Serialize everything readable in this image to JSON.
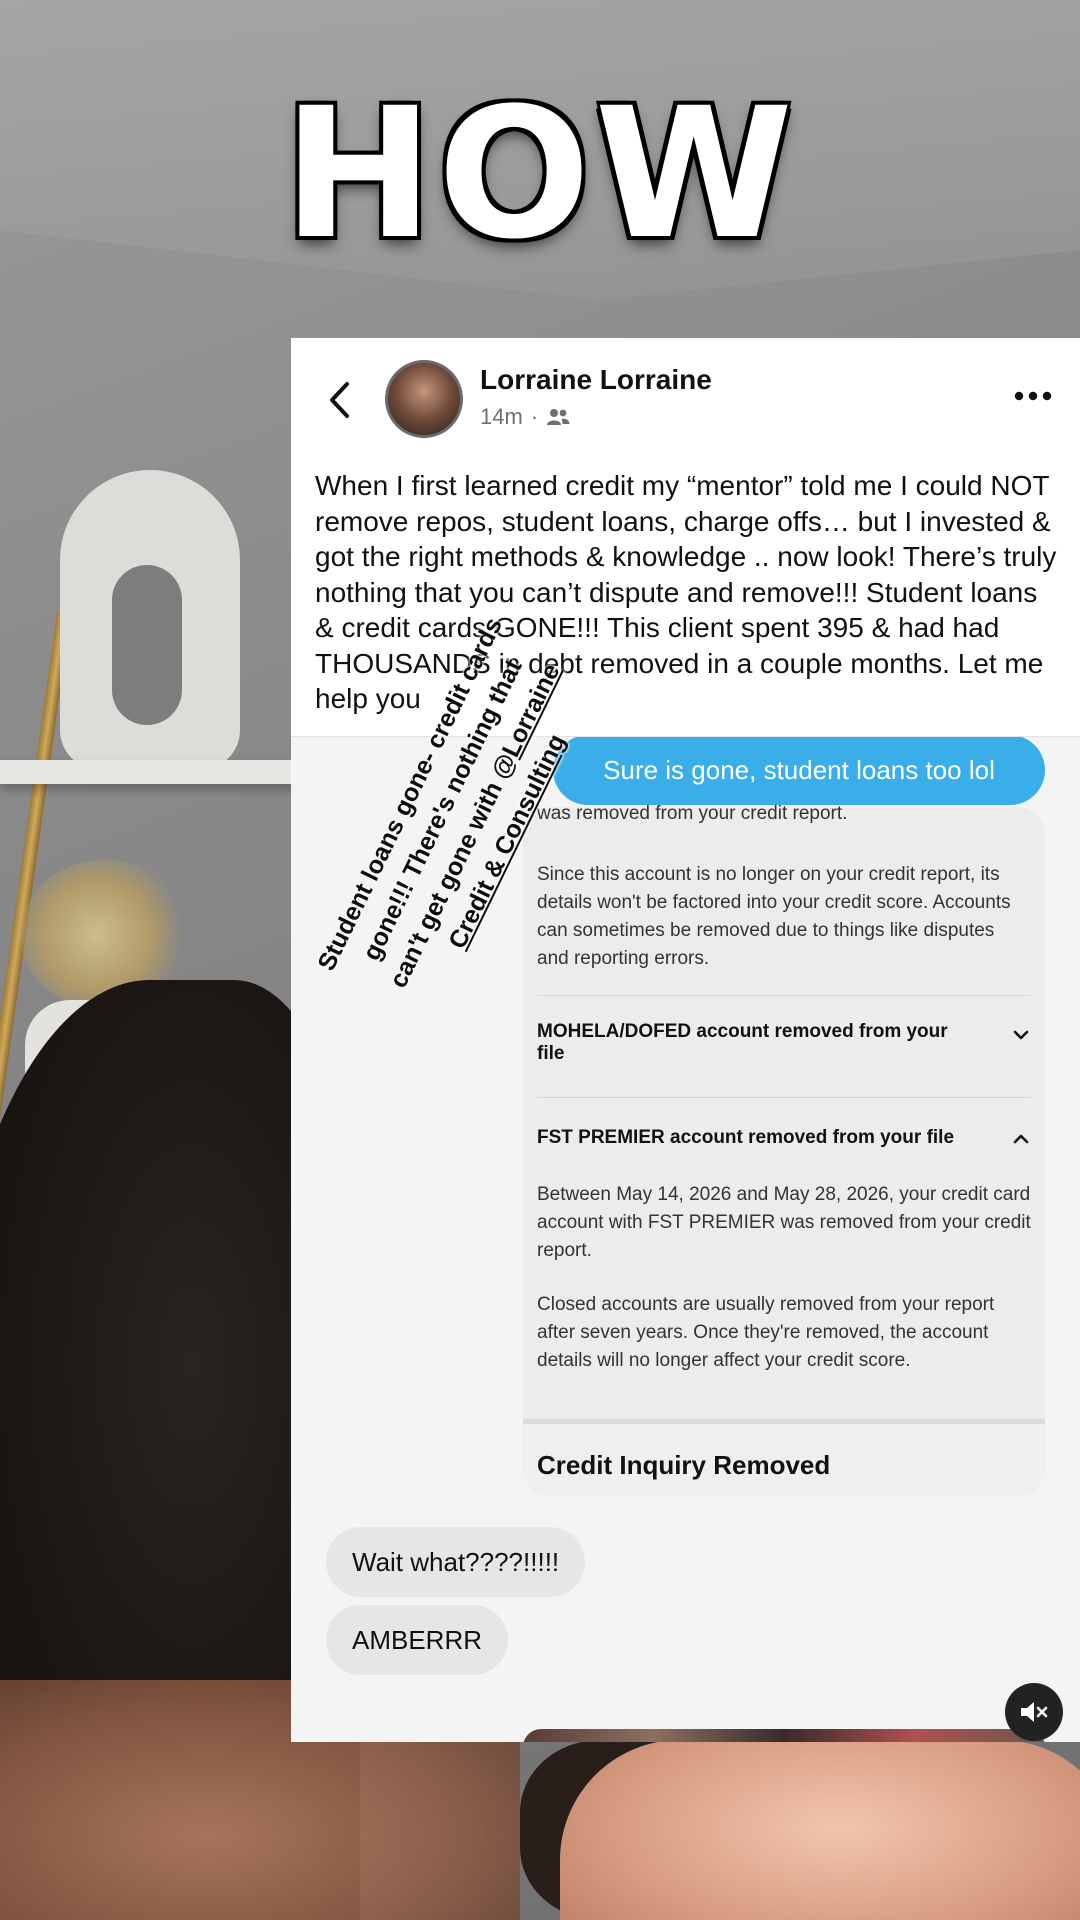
{
  "headline": "HOW",
  "post": {
    "author": "Lorraine Lorraine",
    "time": "14m",
    "separator": "·",
    "audience_icon": "friends-icon",
    "body": "When I first learned credit my “mentor” told me I could NOT remove repos, student loans, charge offs… but I invested & got the right methods & knowledge .. now look! There’s truly nothing that you can’t dispute and remove!!! Student loans & credit cards GONE!!! This client spent 395 & had had THOUSANDS in debt removed in a couple months. Let me help you"
  },
  "embed": {
    "outgoing_message": "Sure is gone, student loans too lol",
    "report": {
      "cut_line": "was removed from your credit report.",
      "paragraph1": "Since this account is no longer on your credit report, its details won't be factored into your credit score. Accounts can sometimes be removed due to things like disputes and reporting errors.",
      "item1_title": "MOHELA/DOFED account removed from your file",
      "item2_title": "FST PREMIER account removed from your file",
      "paragraph2": "Between May 14, 2026 and May 28, 2026, your credit card account with FST PREMIER was removed from your credit report.",
      "paragraph3": "Closed accounts are usually removed from your report after seven years. Once they're removed, the account details will no longer affect your credit score.",
      "inquiry_title": "Credit Inquiry Removed"
    },
    "incoming_messages": [
      "Wait what????!!!!!",
      "AMBERRR"
    ],
    "sticker": {
      "line1": "Student loans gone- credit cards",
      "line2": "gone!!! There's nothing that",
      "line3": "can't get gone with @",
      "mention": "Lorraine",
      "line4": "Credit & Consulting"
    }
  },
  "colors": {
    "outgoing_bubble": "#3aaee8",
    "incoming_bubble": "#e6e6e6",
    "report_panel": "#ececec"
  }
}
